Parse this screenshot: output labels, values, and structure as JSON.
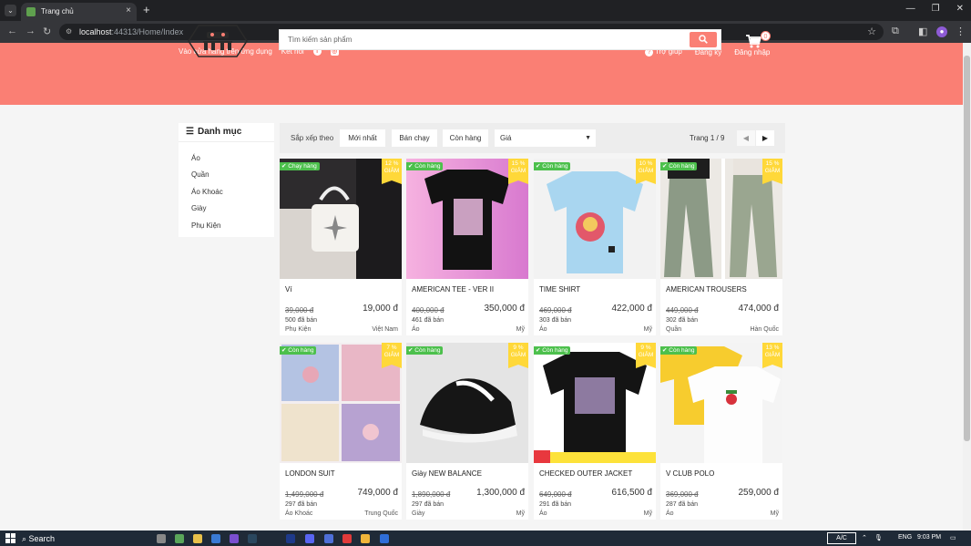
{
  "browser": {
    "tab_title": "Trang chủ",
    "url_host": "localhost",
    "url_path": ":44313/Home/Index"
  },
  "header": {
    "app_link": "Vào cửa hàng trên ứng dụng",
    "connect": "Kết nối",
    "help": "Trợ giúp",
    "register": "Đăng ký",
    "login": "Đăng nhập",
    "search_placeholder": "Tìm kiếm sản phẩm",
    "cart_count": "0",
    "brand_color": "#fa7f74"
  },
  "sidebar": {
    "title": "Danh mục",
    "items": [
      "Áo",
      "Quần",
      "Áo Khoác",
      "Giày",
      "Phụ Kiện"
    ]
  },
  "sort": {
    "label": "Sắp xếp theo",
    "newest": "Mới nhất",
    "best_selling": "Bán chạy",
    "in_stock": "Còn hàng",
    "price_select": "Giá",
    "page_text": "Trang 1 / 9"
  },
  "products": [
    {
      "badge": "Chạy hàng",
      "discount": "12 %",
      "discount_word": "GIẢM",
      "name": "Ví",
      "old_price": "39,000 đ",
      "price": "19,000 đ",
      "sold": "500 đã bán",
      "type": "Phụ Kiện",
      "origin": "Việt Nam",
      "image": "white handbag"
    },
    {
      "badge": "Còn hàng",
      "discount": "15 %",
      "discount_word": "GIẢM",
      "name": "AMERICAN TEE - VER II",
      "old_price": "400,000 đ",
      "price": "350,000 đ",
      "sold": "461 đã bán",
      "type": "Áo",
      "origin": "Mỹ",
      "image": "black tee"
    },
    {
      "badge": "Còn hàng",
      "discount": "10 %",
      "discount_word": "GIẢM",
      "name": "TIME SHIRT",
      "old_price": "469,000 đ",
      "price": "422,000 đ",
      "sold": "303 đã bán",
      "type": "Áo",
      "origin": "Mỹ",
      "image": "blue tee"
    },
    {
      "badge": "Còn hàng",
      "discount": "15 %",
      "discount_word": "GIẢM",
      "name": "AMERICAN TROUSERS",
      "old_price": "449,000 đ",
      "price": "474,000 đ",
      "sold": "302 đã bán",
      "type": "Quần",
      "origin": "Hàn Quốc",
      "image": "wide jeans"
    },
    {
      "badge": "Còn hàng",
      "discount": "7 %",
      "discount_word": "GIẢM",
      "name": "LONDON SUIT",
      "old_price": "1,499,000 đ",
      "price": "749,000 đ",
      "sold": "297 đã bán",
      "type": "Áo Khoác",
      "origin": "Trung Quốc",
      "image": "hoodies"
    },
    {
      "badge": "Còn hàng",
      "discount": "9 %",
      "discount_word": "GIẢM",
      "name": "Giày NEW BALANCE",
      "old_price": "1,890,000 đ",
      "price": "1,300,000 đ",
      "sold": "297 đã bán",
      "type": "Giày",
      "origin": "Mỹ",
      "image": "sneaker"
    },
    {
      "badge": "Còn hàng",
      "discount": "9 %",
      "discount_word": "GIẢM",
      "name": "CHECKED OUTER JACKET",
      "old_price": "649,000 đ",
      "price": "616,500 đ",
      "sold": "291 đã bán",
      "type": "Áo",
      "origin": "Mỹ",
      "image": "black printed tee"
    },
    {
      "badge": "Còn hàng",
      "discount": "13 %",
      "discount_word": "GIẢM",
      "name": "V CLUB POLO",
      "old_price": "369,000 đ",
      "price": "259,000 đ",
      "sold": "287 đã bán",
      "type": "Áo",
      "origin": "Mỹ",
      "image": "yellow white tees"
    }
  ],
  "taskbar": {
    "search": "Search",
    "lang_box": "A/C",
    "lang": "ENG",
    "time": "9:03 PM"
  }
}
